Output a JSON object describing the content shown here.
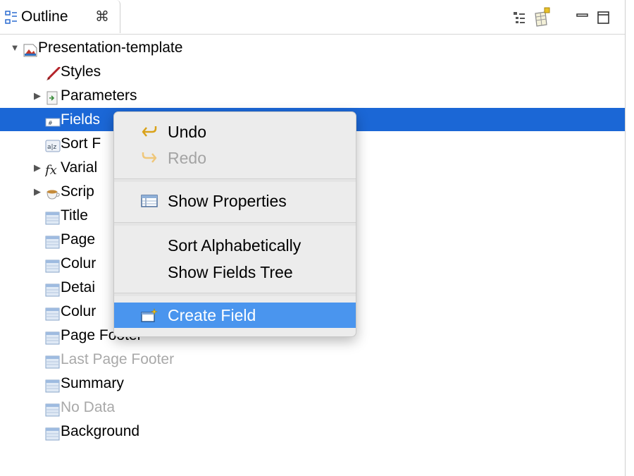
{
  "tab": {
    "title": "Outline",
    "close_glyph": "⌘"
  },
  "toolbar": [
    {
      "icon": "tree-layout-icon"
    },
    {
      "icon": "new-table-icon"
    },
    {
      "icon": "minimize-icon"
    },
    {
      "icon": "maximize-icon"
    }
  ],
  "tree": [
    {
      "label": "Presentation-template",
      "icon": "report-icon",
      "twisty": "▼",
      "state": "normal"
    },
    {
      "label": "Styles",
      "icon": "brush-icon",
      "twisty": "",
      "state": "normal"
    },
    {
      "label": "Parameters",
      "icon": "parameters-icon",
      "twisty": "▶",
      "state": "normal"
    },
    {
      "label": "Fields",
      "icon": "fields-icon",
      "twisty": "",
      "state": "selected"
    },
    {
      "label": "Sort F",
      "icon": "sort-icon",
      "twisty": "",
      "state": "normal"
    },
    {
      "label": "Varial",
      "icon": "fx-icon",
      "twisty": "▶",
      "state": "normal"
    },
    {
      "label": "Scrip",
      "icon": "scriptlet-icon",
      "twisty": "▶",
      "state": "normal"
    },
    {
      "label": "Title",
      "icon": "band-icon",
      "twisty": "",
      "state": "normal"
    },
    {
      "label": "Page",
      "icon": "band-icon",
      "twisty": "",
      "state": "normal"
    },
    {
      "label": "Colur",
      "icon": "band-icon",
      "twisty": "",
      "state": "normal"
    },
    {
      "label": "Detai",
      "icon": "band-icon",
      "twisty": "",
      "state": "normal"
    },
    {
      "label": "Colur",
      "icon": "band-icon",
      "twisty": "",
      "state": "normal"
    },
    {
      "label": "Page Footer",
      "icon": "band-icon",
      "twisty": "",
      "state": "normal"
    },
    {
      "label": "Last Page Footer",
      "icon": "band-icon",
      "twisty": "",
      "state": "disabled"
    },
    {
      "label": "Summary",
      "icon": "band-icon",
      "twisty": "",
      "state": "normal"
    },
    {
      "label": "No Data",
      "icon": "band-icon",
      "twisty": "",
      "state": "disabled"
    },
    {
      "label": "Background",
      "icon": "band-icon",
      "twisty": "",
      "state": "normal"
    }
  ],
  "context_menu": {
    "undo": "Undo",
    "redo": "Redo",
    "show_properties": "Show Properties",
    "sort_alphabetically": "Sort Alphabetically",
    "show_fields_tree": "Show Fields Tree",
    "create_field": "Create Field"
  },
  "colors": {
    "selection": "#1b67d6",
    "menu_highlight": "#4a95ee",
    "menu_bg": "#ececec"
  }
}
